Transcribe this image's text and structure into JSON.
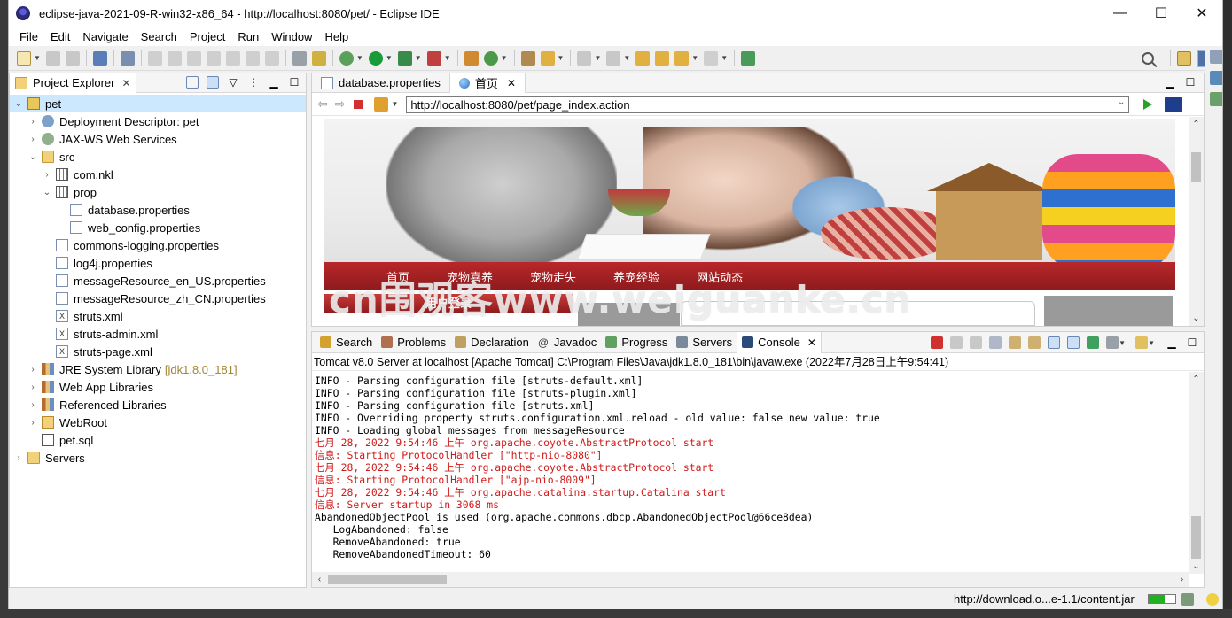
{
  "window": {
    "title": "eclipse-java-2021-09-R-win32-x86_64 - http://localhost:8080/pet/ - Eclipse IDE",
    "controls": [
      "—",
      "☐",
      "✕"
    ]
  },
  "menu": [
    "File",
    "Edit",
    "Navigate",
    "Search",
    "Project",
    "Run",
    "Window",
    "Help"
  ],
  "project_explorer": {
    "tab_label": "Project Explorer",
    "items": [
      {
        "label": "pet",
        "icon": "project-icon"
      },
      {
        "label": "Deployment Descriptor: pet",
        "icon": "deployment-descriptor-icon"
      },
      {
        "label": "JAX-WS Web Services",
        "icon": "web-services-icon"
      },
      {
        "label": "src",
        "icon": "source-folder-icon"
      },
      {
        "label": "com.nkl",
        "icon": "package-icon"
      },
      {
        "label": "prop",
        "icon": "package-icon"
      },
      {
        "label": "database.properties",
        "icon": "properties-file-icon"
      },
      {
        "label": "web_config.properties",
        "icon": "properties-file-icon"
      },
      {
        "label": "commons-logging.properties",
        "icon": "properties-file-icon"
      },
      {
        "label": "log4j.properties",
        "icon": "properties-file-icon"
      },
      {
        "label": "messageResource_en_US.properties",
        "icon": "properties-file-icon"
      },
      {
        "label": "messageResource_zh_CN.properties",
        "icon": "properties-file-icon"
      },
      {
        "label": "struts.xml",
        "icon": "xml-file-icon"
      },
      {
        "label": "struts-admin.xml",
        "icon": "xml-file-icon"
      },
      {
        "label": "struts-page.xml",
        "icon": "xml-file-icon"
      },
      {
        "label": "JRE System Library",
        "suffix": "[jdk1.8.0_181]",
        "icon": "library-icon"
      },
      {
        "label": "Web App Libraries",
        "icon": "library-icon"
      },
      {
        "label": "Referenced Libraries",
        "icon": "library-icon"
      },
      {
        "label": "WebRoot",
        "icon": "web-folder-icon"
      },
      {
        "label": "pet.sql",
        "icon": "sql-file-icon"
      },
      {
        "label": "Servers",
        "icon": "folder-icon"
      }
    ]
  },
  "editor": {
    "tabs": [
      {
        "label": "database.properties"
      },
      {
        "label": "首页"
      }
    ],
    "url": "http://localhost:8080/pet/page_index.action",
    "page": {
      "nav": [
        "首页",
        "宠物喜养",
        "宠物走失",
        "养宠经验",
        "网站动态"
      ],
      "login_header": "用户登录"
    }
  },
  "watermark": "cn围观客www.weiguanke.cn",
  "console": {
    "tabs": [
      "Search",
      "Problems",
      "Declaration",
      "Javadoc",
      "Progress",
      "Servers",
      "Console"
    ],
    "description": "Tomcat v8.0 Server at localhost [Apache Tomcat] C:\\Program Files\\Java\\jdk1.8.0_181\\bin\\javaw.exe  (2022年7月28日上午9:54:41)",
    "lines": [
      {
        "text": "INFO - Parsing configuration file [struts-default.xml]",
        "err": false
      },
      {
        "text": "INFO - Parsing configuration file [struts-plugin.xml]",
        "err": false
      },
      {
        "text": "INFO - Parsing configuration file [struts.xml]",
        "err": false
      },
      {
        "text": "INFO - Overriding property struts.configuration.xml.reload - old value: false new value: true",
        "err": false
      },
      {
        "text": "INFO - Loading global messages from messageResource",
        "err": false
      },
      {
        "text": "七月 28, 2022 9:54:46 上午 org.apache.coyote.AbstractProtocol start",
        "err": true
      },
      {
        "text": "信息: Starting ProtocolHandler [\"http-nio-8080\"]",
        "err": true
      },
      {
        "text": "七月 28, 2022 9:54:46 上午 org.apache.coyote.AbstractProtocol start",
        "err": true
      },
      {
        "text": "信息: Starting ProtocolHandler [\"ajp-nio-8009\"]",
        "err": true
      },
      {
        "text": "七月 28, 2022 9:54:46 上午 org.apache.catalina.startup.Catalina start",
        "err": true
      },
      {
        "text": "信息: Server startup in 3068 ms",
        "err": true
      },
      {
        "text": "AbandonedObjectPool is used (org.apache.commons.dbcp.AbandonedObjectPool@66ce8dea)",
        "err": false
      },
      {
        "text": "   LogAbandoned: false",
        "err": false
      },
      {
        "text": "   RemoveAbandoned: true",
        "err": false
      },
      {
        "text": "   RemoveAbandonedTimeout: 60",
        "err": false
      }
    ]
  },
  "status": {
    "url": "http://download.o...e-1.1/content.jar",
    "progress": 0.6
  }
}
